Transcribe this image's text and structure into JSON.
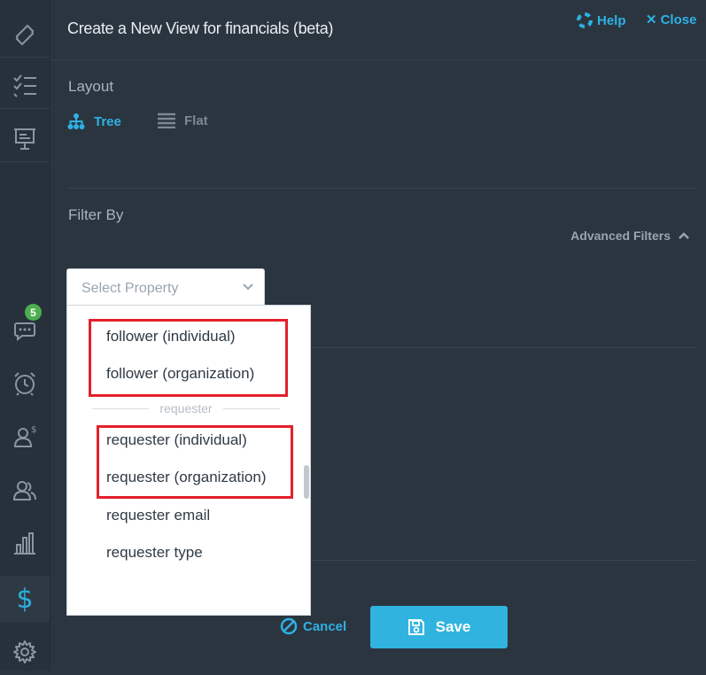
{
  "header": {
    "title": "Create a New View for financials (beta)",
    "help_label": "Help",
    "close_label": "Close"
  },
  "sidebar": {
    "items": [
      {
        "icon": "ticket-icon"
      },
      {
        "icon": "checklist-icon"
      },
      {
        "icon": "presentation-icon"
      },
      {
        "icon": "chat-icon",
        "badge": "5"
      },
      {
        "icon": "alarm-clock-icon"
      },
      {
        "icon": "user-dollar-icon"
      },
      {
        "icon": "users-icon"
      },
      {
        "icon": "bar-chart-icon"
      },
      {
        "icon": "dollar-icon",
        "active": true
      },
      {
        "icon": "gear-icon"
      }
    ]
  },
  "layout": {
    "label": "Layout",
    "options": [
      {
        "label": "Tree",
        "icon": "tree-icon",
        "selected": true
      },
      {
        "label": "Flat",
        "icon": "list-icon",
        "selected": false
      }
    ]
  },
  "filter": {
    "label": "Filter By",
    "advanced_label": "Advanced Filters",
    "select_placeholder": "Select Property"
  },
  "dropdown": {
    "options_top": [
      "follower (individual)",
      "follower (organization)"
    ],
    "group_label": "requester",
    "options_group": [
      "requester (individual)",
      "requester (organization)",
      "requester email",
      "requester type"
    ]
  },
  "footer": {
    "cancel_label": "Cancel",
    "save_label": "Save"
  },
  "colors": {
    "accent": "#2eb1e3",
    "background": "#2b3540",
    "highlight": "#e3202b",
    "badge": "#4caf50"
  }
}
